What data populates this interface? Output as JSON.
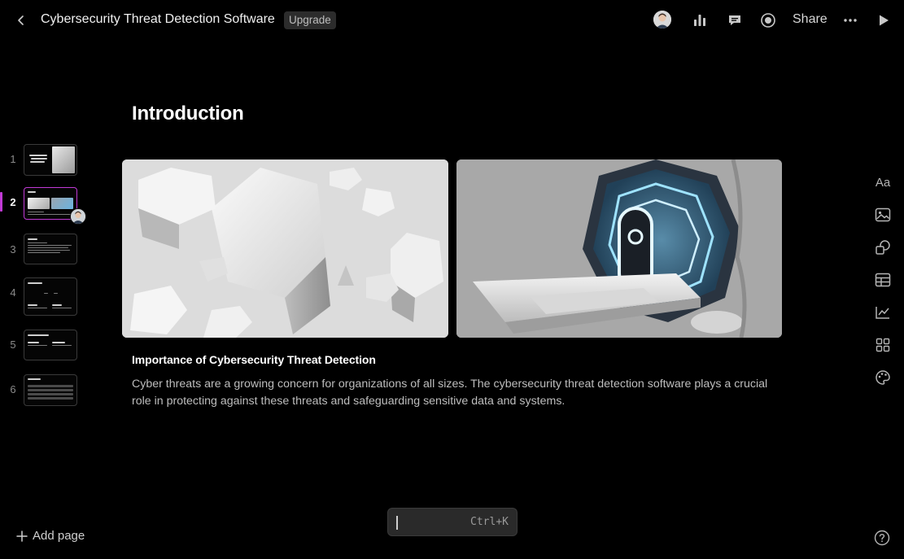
{
  "header": {
    "back_icon": "chevron-left-icon",
    "title": "Cybersecurity Threat Detection Software",
    "upgrade_label": "Upgrade",
    "share_label": "Share",
    "icons": [
      "user-avatar",
      "analytics-icon",
      "comment-icon",
      "record-icon",
      "more-icon",
      "play-icon"
    ]
  },
  "slides": [
    {
      "number": "1"
    },
    {
      "number": "2",
      "active": true
    },
    {
      "number": "3"
    },
    {
      "number": "4"
    },
    {
      "number": "5"
    },
    {
      "number": "6"
    }
  ],
  "sidebar": {
    "add_page_label": "Add page"
  },
  "main": {
    "title": "Introduction",
    "section_heading": "Importance of Cybersecurity Threat Detection",
    "section_body": "Cyber threats are a growing concern for organizations of all sizes. The cybersecurity threat detection software plays a crucial role in protecting against these threats and safeguarding sensitive data and systems."
  },
  "toolbar": {
    "text_style_label": "Aa",
    "icons": [
      "text-style-icon",
      "image-icon",
      "shapes-icon",
      "table-icon",
      "chart-icon",
      "grid-icon",
      "palette-icon"
    ]
  },
  "command_bar": {
    "shortcut": "Ctrl+K"
  },
  "colors": {
    "background": "#000000",
    "accent": "#c13ad6",
    "text": "#ffffff",
    "muted_text": "#bdbdbd"
  }
}
